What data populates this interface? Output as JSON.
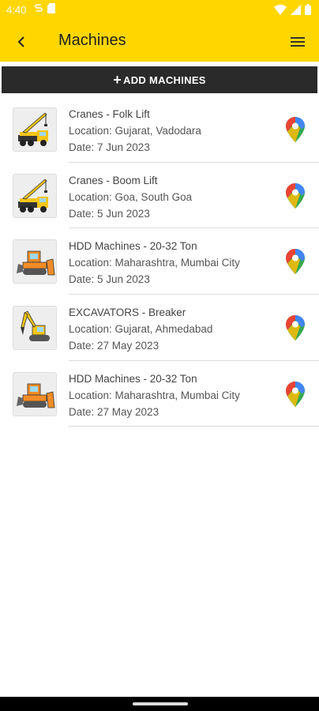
{
  "status_bar": {
    "time": "4:40"
  },
  "app_bar": {
    "title": "Machines"
  },
  "add_button": {
    "plus": "+",
    "label": "ADD MACHINES"
  },
  "colors": {
    "accent": "#FFD600",
    "button_bg": "#2a2a2a"
  },
  "machines": [
    {
      "name": "Cranes - Folk Lift",
      "location": "Location: Gujarat, Vadodara",
      "date": "Date: 7 Jun 2023",
      "icon": "crane-truck-icon"
    },
    {
      "name": "Cranes - Boom Lift",
      "location": "Location: Goa, South Goa",
      "date": "Date: 5 Jun 2023",
      "icon": "crane-truck-icon"
    },
    {
      "name": "HDD Machines - 20-32 Ton",
      "location": "Location: Maharashtra, Mumbai City",
      "date": "Date: 5 Jun 2023",
      "icon": "bulldozer-icon"
    },
    {
      "name": "EXCAVATORS - Breaker",
      "location": "Location: Gujarat, Ahmedabad",
      "date": "Date: 27 May 2023",
      "icon": "excavator-icon"
    },
    {
      "name": "HDD Machines - 20-32 Ton",
      "location": "Location: Maharashtra, Mumbai City",
      "date": "Date: 27 May 2023",
      "icon": "bulldozer-icon"
    }
  ]
}
